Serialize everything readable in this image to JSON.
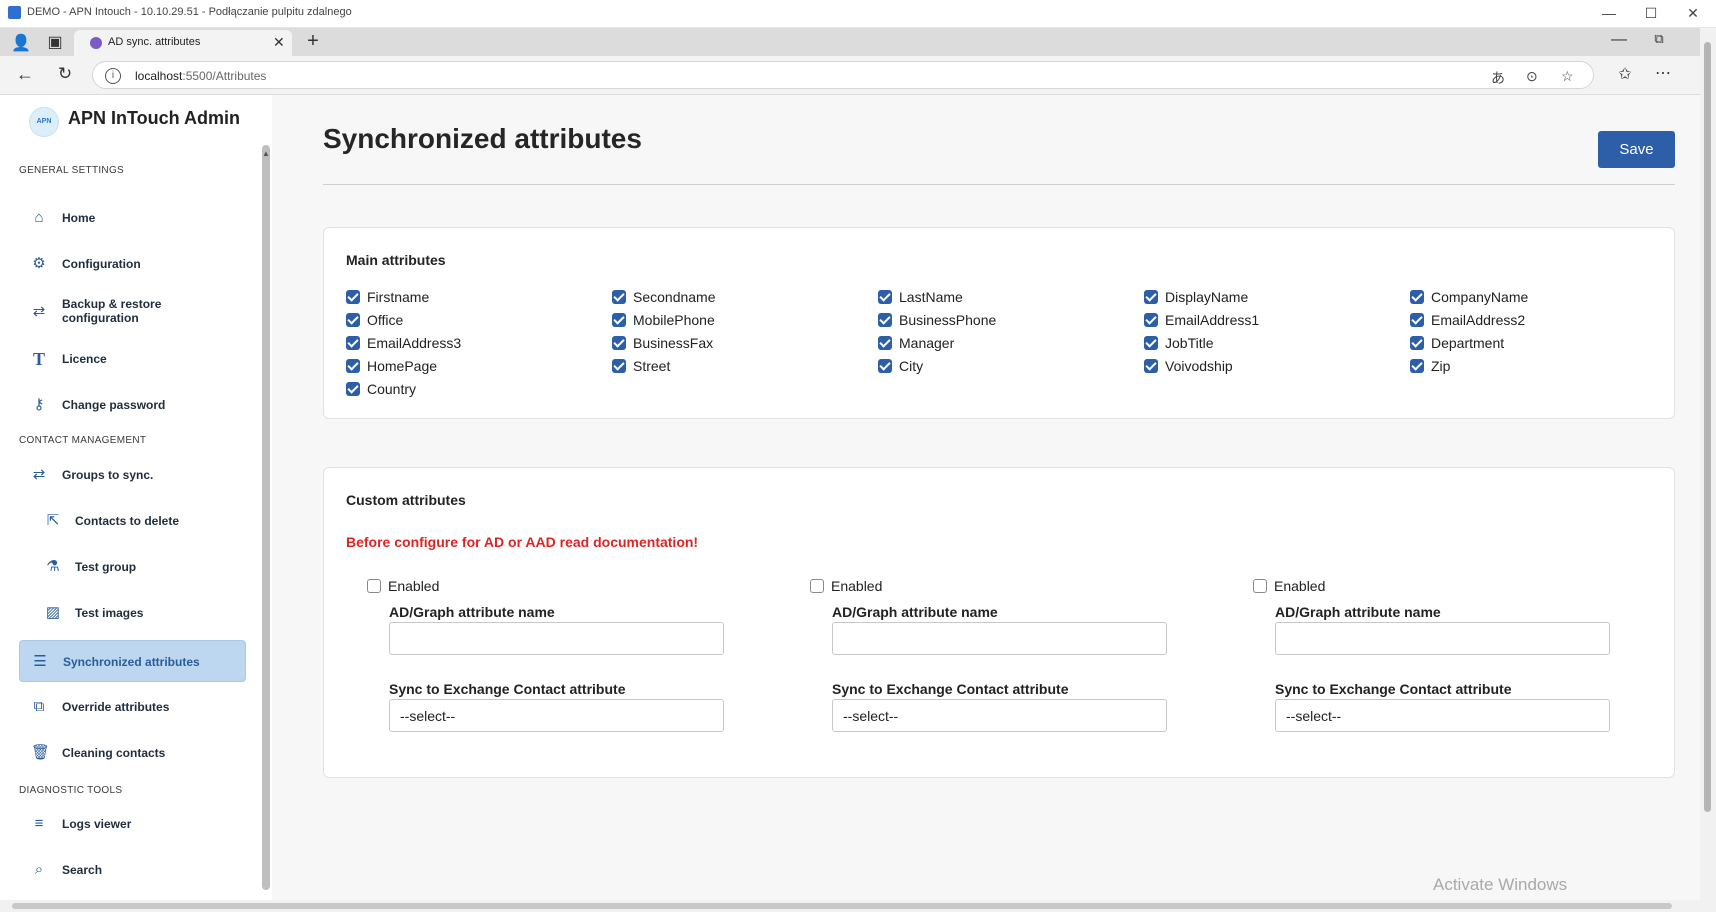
{
  "rdp_window": {
    "title": "DEMO - APN Intouch - 10.10.29.51 - Podłączanie pulpitu zdalnego",
    "controls": [
      "—",
      "☐",
      "✕"
    ]
  },
  "browser": {
    "tab_title": "AD sync. attributes",
    "url_host": "localhost",
    "url_path": ":5500/Attributes",
    "tab_close": "✕",
    "new_tab": "+"
  },
  "sidebar": {
    "logo_text": "APN",
    "brand": "APN InTouch Admin",
    "sections": {
      "general": "GENERAL SETTINGS",
      "contact": "CONTACT MANAGEMENT",
      "diagnostic": "DIAGNOSTIC TOOLS"
    },
    "items": [
      {
        "label": "Home",
        "icon": "home-icon"
      },
      {
        "label": "Configuration",
        "icon": "gear-icon"
      },
      {
        "label": "Backup & restore configuration",
        "icon": "swap-icon"
      },
      {
        "label": "Licence",
        "icon": "licence-icon"
      },
      {
        "label": "Change password",
        "icon": "key-icon"
      },
      {
        "label": "Groups to sync.",
        "icon": "swap-icon"
      },
      {
        "label": "Contacts to delete",
        "icon": "export-icon"
      },
      {
        "label": "Test group",
        "icon": "flask-icon"
      },
      {
        "label": "Test images",
        "icon": "image-icon"
      },
      {
        "label": "Synchronized attributes",
        "icon": "list-icon"
      },
      {
        "label": "Override attributes",
        "icon": "override-icon"
      },
      {
        "label": "Cleaning contacts",
        "icon": "trash-icon"
      },
      {
        "label": "Logs viewer",
        "icon": "lines-icon"
      },
      {
        "label": "Search",
        "icon": "search-icon"
      }
    ],
    "backup_line1": "Backup & restore",
    "backup_line2": "configuration"
  },
  "main": {
    "title": "Synchronized attributes",
    "save_label": "Save",
    "main_attributes": {
      "title": "Main attributes",
      "items": [
        {
          "label": "Firstname",
          "checked": true
        },
        {
          "label": "Secondname",
          "checked": true
        },
        {
          "label": "LastName",
          "checked": true
        },
        {
          "label": "DisplayName",
          "checked": true
        },
        {
          "label": "CompanyName",
          "checked": true
        },
        {
          "label": "Office",
          "checked": true
        },
        {
          "label": "MobilePhone",
          "checked": true
        },
        {
          "label": "BusinessPhone",
          "checked": true
        },
        {
          "label": "EmailAddress1",
          "checked": true
        },
        {
          "label": "EmailAddress2",
          "checked": true
        },
        {
          "label": "EmailAddress3",
          "checked": true
        },
        {
          "label": "BusinessFax",
          "checked": true
        },
        {
          "label": "Manager",
          "checked": true
        },
        {
          "label": "JobTitle",
          "checked": true
        },
        {
          "label": "Department",
          "checked": true
        },
        {
          "label": "HomePage",
          "checked": true
        },
        {
          "label": "Street",
          "checked": true
        },
        {
          "label": "City",
          "checked": true
        },
        {
          "label": "Voivodship",
          "checked": true
        },
        {
          "label": "Zip",
          "checked": true
        },
        {
          "label": "Country",
          "checked": true
        }
      ]
    },
    "custom_attributes": {
      "title": "Custom attributes",
      "warning": "Before configure for AD or AAD read documentation!",
      "columns": [
        {
          "enabled_label": "Enabled",
          "enabled": false,
          "name_label": "AD/Graph attribute name",
          "name_value": "",
          "sync_label": "Sync to Exchange Contact attribute",
          "sync_value": "--select--"
        },
        {
          "enabled_label": "Enabled",
          "enabled": false,
          "name_label": "AD/Graph attribute name",
          "name_value": "",
          "sync_label": "Sync to Exchange Contact attribute",
          "sync_value": "--select--"
        },
        {
          "enabled_label": "Enabled",
          "enabled": false,
          "name_label": "AD/Graph attribute name",
          "name_value": "",
          "sync_label": "Sync to Exchange Contact attribute",
          "sync_value": "--select--"
        }
      ]
    }
  },
  "watermark": "Activate Windows",
  "colors": {
    "accent": "#2c5fa8",
    "active_nav_bg": "#bcd7ef",
    "warning": "#d92626"
  }
}
